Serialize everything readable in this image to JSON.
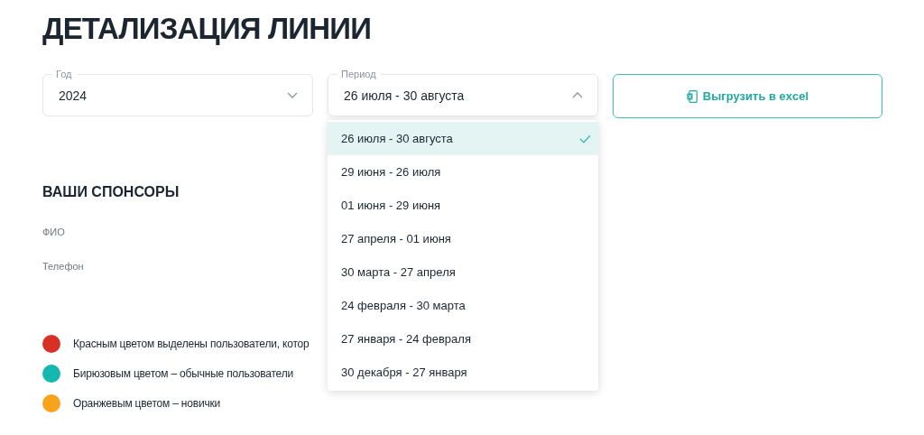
{
  "title": "ДЕТАЛИЗАЦИЯ ЛИНИИ",
  "year_select": {
    "label": "Год",
    "value": "2024",
    "expanded": false
  },
  "period_select": {
    "label": "Период",
    "value": "26 июля - 30 августа",
    "expanded": true
  },
  "export_button": {
    "label": "Выгрузить в excel"
  },
  "period_options": [
    {
      "label": "26 июля - 30 августа",
      "selected": true
    },
    {
      "label": "29 июня - 26 июля",
      "selected": false
    },
    {
      "label": "01 июня - 29 июня",
      "selected": false
    },
    {
      "label": "27 апреля - 01 июня",
      "selected": false
    },
    {
      "label": "30 марта - 27 апреля",
      "selected": false
    },
    {
      "label": "24 февраля - 30 марта",
      "selected": false
    },
    {
      "label": "27 января - 24 февраля",
      "selected": false
    },
    {
      "label": "30 декабря - 27 января",
      "selected": false
    }
  ],
  "sponsors": {
    "heading": "ВАШИ СПОНСОРЫ",
    "fields": [
      "ФИО",
      "Телефон"
    ]
  },
  "legend": [
    {
      "color": "#d93025",
      "text": "Красным цветом выделены пользователи, котор"
    },
    {
      "color": "#14b8b0",
      "text": "Бирюзовым цветом – обычные пользователи"
    },
    {
      "color": "#f9a21b",
      "text": "Оранжевым цветом – новички"
    }
  ]
}
